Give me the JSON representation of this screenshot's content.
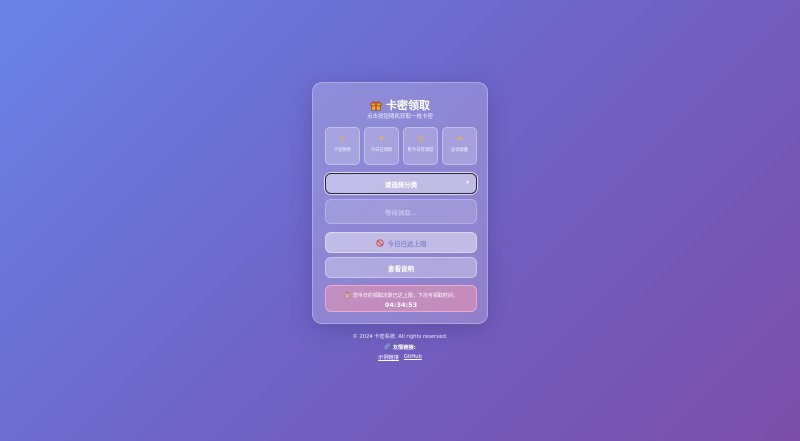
{
  "card": {
    "title": "卡密领取",
    "subtitle": "点击按钮随机获取一枚卡密",
    "stats": [
      {
        "icon": "ticket-icon",
        "glyph": "▯",
        "label": "卡密剩余"
      },
      {
        "icon": "star-icon",
        "glyph": "✶",
        "label": "今日已领取"
      },
      {
        "icon": "clock-icon",
        "glyph": "◷",
        "label": "距今日可领取"
      },
      {
        "icon": "infinity-icon",
        "glyph": "∞",
        "label": "总领取量"
      }
    ],
    "category_select": {
      "value": "请选择分类",
      "arrow": "▾"
    },
    "result_placeholder": "等待领取...",
    "limit_button": "今日已达上限",
    "help_button": "查看说明",
    "notice": {
      "icon": "⏳",
      "message": "您今日的领取次数已达上限，下次可领取时间：",
      "countdown": "04:34:53"
    }
  },
  "footer": {
    "copyright": "© 2024 卡密系统. All rights reserved.",
    "friends_icon": "🔗",
    "friends_label": "友情链接:",
    "links": [
      "示例链接",
      "GitHub"
    ]
  },
  "colors": {
    "accent": "#f5b52a",
    "limit_text": "#8a86c9",
    "notice_bg": "#ec96af"
  }
}
